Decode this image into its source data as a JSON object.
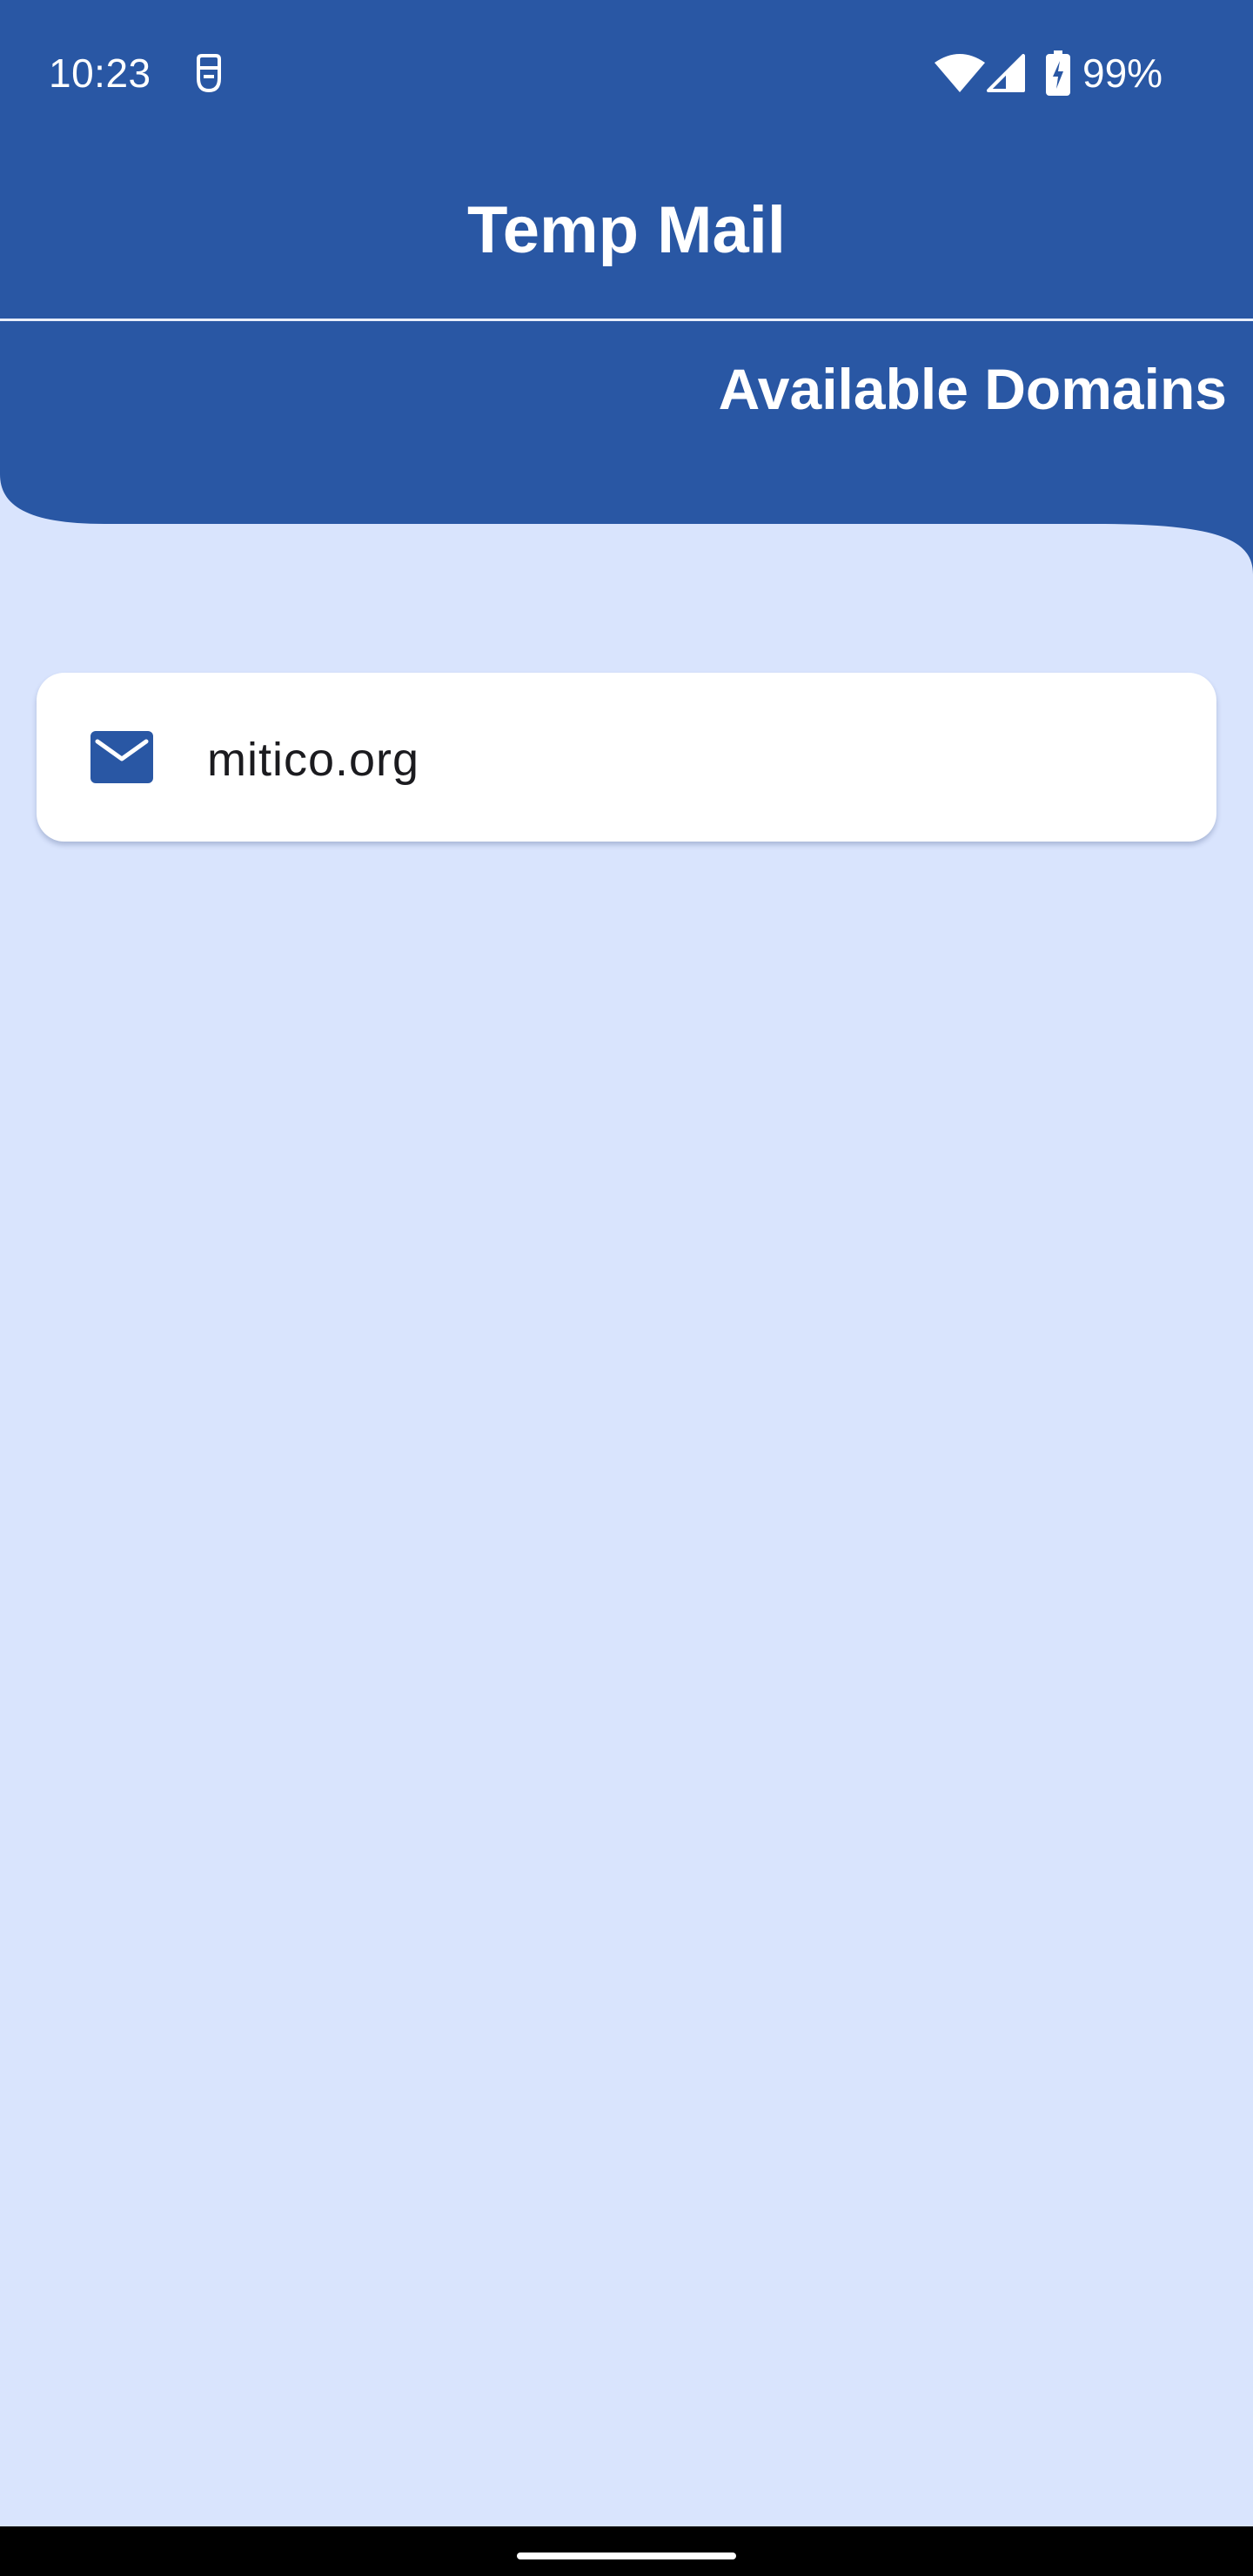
{
  "status_bar": {
    "time": "10:23",
    "battery_percent": "99%",
    "icons": [
      "developer-icon",
      "wifi-icon",
      "signal-icon",
      "battery-charging-icon"
    ]
  },
  "app_bar": {
    "title": "Temp Mail"
  },
  "section": {
    "title": "Available Domains"
  },
  "domains": [
    {
      "icon": "mail-icon",
      "name": "mitico.org"
    }
  ],
  "colors": {
    "primary": "#2957a4",
    "background": "#d9e4fd",
    "card": "#ffffff",
    "text": "#1b1b1f"
  }
}
